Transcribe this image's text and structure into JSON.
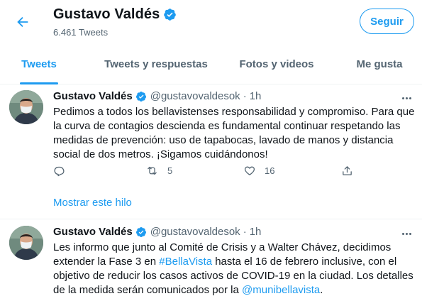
{
  "header": {
    "title": "Gustavo Valdés",
    "tweet_count": "6.461 Tweets",
    "follow_label": "Seguir"
  },
  "tabs": [
    {
      "label": "Tweets",
      "active": true
    },
    {
      "label": "Tweets y respuestas",
      "active": false
    },
    {
      "label": "Fotos y videos",
      "active": false
    },
    {
      "label": "Me gusta",
      "active": false
    }
  ],
  "tweets": [
    {
      "name": "Gustavo Valdés",
      "handle": "@gustavovaldesok",
      "separator": "·",
      "time": "1h",
      "text": "Pedimos a todos los bellavistenses responsabilidad y compromiso. Para que la curva de contagios descienda es fundamental continuar respetando las medidas de prevención: uso de tapabocas, lavado de manos y distancia social de dos metros. ¡Sigamos cuidándonos!",
      "retweets": "5",
      "likes": "16",
      "show_thread": "Mostrar este hilo"
    },
    {
      "name": "Gustavo Valdés",
      "handle": "@gustavovaldesok",
      "separator": "·",
      "time": "1h",
      "text_part1": "Les informo que junto al Comité de Crisis y a Walter Chávez, decidimos extender la Fase 3 en ",
      "hashtag": "#BellaVista",
      "text_part2": " hasta el 16 de febrero inclusive, con el objetivo de reducir los casos activos de COVID-19 en la ciudad. Los detalles de la medida serán comunicados por la ",
      "mention": "@munibellavista",
      "text_part3": "."
    }
  ],
  "colors": {
    "accent": "#1d9bf0",
    "text": "#0f1419",
    "secondary": "#536471",
    "divider": "#eff3f4"
  },
  "icons": [
    "back-arrow-icon",
    "verified-badge-icon",
    "reply-icon",
    "retweet-icon",
    "like-icon",
    "share-icon",
    "more-icon"
  ]
}
